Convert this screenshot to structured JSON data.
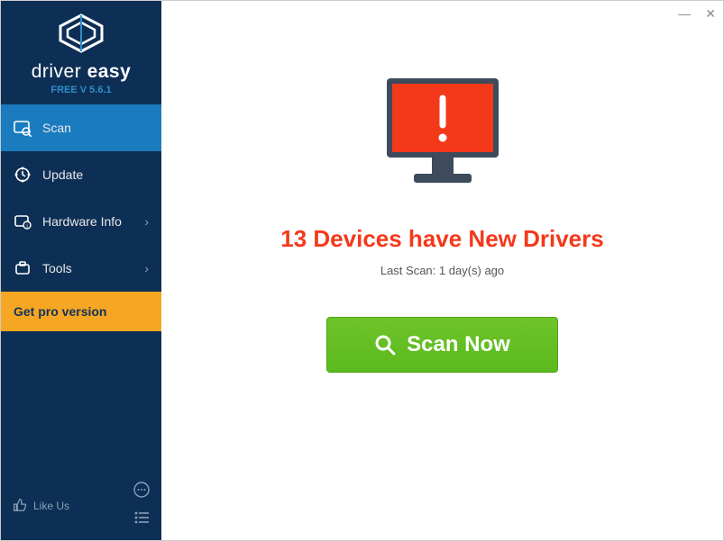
{
  "brand": {
    "light": "driver",
    "bold": "easy",
    "version": "FREE V 5.6.1"
  },
  "nav": {
    "scan": "Scan",
    "update": "Update",
    "hardware": "Hardware Info",
    "tools": "Tools",
    "pro": "Get pro version"
  },
  "sidebar_bottom": {
    "like_us": "Like Us"
  },
  "titlebar": {
    "minimize": "—",
    "close": "✕"
  },
  "main": {
    "headline": "13 Devices have New Drivers",
    "last_scan": "Last Scan: 1 day(s) ago",
    "scan_button": "Scan Now"
  }
}
